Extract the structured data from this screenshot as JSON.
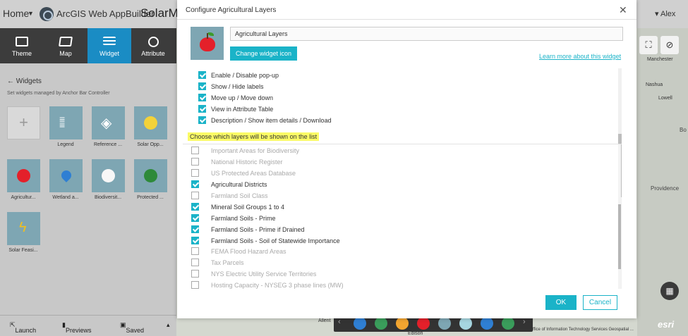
{
  "topbar": {
    "home": "Home",
    "brand": "ArcGIS Web AppBuilder",
    "app_name": "SolarMap",
    "user": "Alex"
  },
  "left_panel": {
    "tabs": [
      {
        "label": "Theme",
        "icon": "theme-icon"
      },
      {
        "label": "Map",
        "icon": "map-icon"
      },
      {
        "label": "Widget",
        "icon": "widget-icon",
        "active": true
      },
      {
        "label": "Attribute",
        "icon": "attribute-icon"
      }
    ],
    "widgets_title": "Widgets",
    "widgets_subtitle": "Set widgets managed by Anchor Bar Controller",
    "widgets": [
      {
        "label": "Legend"
      },
      {
        "label": "Reference ..."
      },
      {
        "label": "Solar Opp..."
      },
      {
        "label": "Agricultur..."
      },
      {
        "label": "Wetland a..."
      },
      {
        "label": "Biodiversit..."
      },
      {
        "label": "Protected ..."
      },
      {
        "label": "Solar Feasi..."
      }
    ],
    "bottom": {
      "launch": "Launch",
      "previews": "Previews",
      "saved": "Saved"
    }
  },
  "map": {
    "cities": [
      "Manchester",
      "Nashua",
      "Lowell",
      "Bo",
      "Providence"
    ],
    "other_labels": [
      "Allent",
      "Edison",
      "ffice of Information Technology Services Geospatial ...",
      "esri"
    ]
  },
  "modal": {
    "title": "Configure Agricultural Layers",
    "widget_name": "Agricultural Layers",
    "change_icon_label": "Change widget icon",
    "learn_more": "Learn more about this widget",
    "options": [
      {
        "label": "Enable / Disable pop-up",
        "checked": true
      },
      {
        "label": "Show / Hide labels",
        "checked": true
      },
      {
        "label": "Move up / Move down",
        "checked": true
      },
      {
        "label": "View in Attribute Table",
        "checked": true
      },
      {
        "label": "Description / Show item details / Download",
        "checked": true
      }
    ],
    "choose_hint": "Choose which layers will be shown on the list",
    "layers": [
      {
        "label": "Important Areas for Biodiversity",
        "checked": false
      },
      {
        "label": "National Historic Register",
        "checked": false
      },
      {
        "label": "US Protected Areas Database",
        "checked": false
      },
      {
        "label": "Agricultural Districts",
        "checked": true
      },
      {
        "label": "Farmland Soil Class",
        "checked": false
      },
      {
        "label": "Mineral Soil Groups 1 to 4",
        "checked": true
      },
      {
        "label": "Farmland Soils - Prime",
        "checked": true
      },
      {
        "label": "Farmland Soils - Prime if Drained",
        "checked": true
      },
      {
        "label": "Farmland Soils - Soil of Statewide Importance",
        "checked": true
      },
      {
        "label": "FEMA Flood Hazard Areas",
        "checked": false
      },
      {
        "label": "Tax Parcels",
        "checked": false
      },
      {
        "label": "NYS Electric Utility Service Territories",
        "checked": false
      },
      {
        "label": "Hosting Capacity - NYSEG 3 phase lines (MW)",
        "checked": false
      }
    ],
    "ok_label": "OK",
    "cancel_label": "Cancel"
  },
  "colors": {
    "accent": "#1ab3c8",
    "highlight": "#fbfb66",
    "tab_active": "#1a8cc4"
  }
}
